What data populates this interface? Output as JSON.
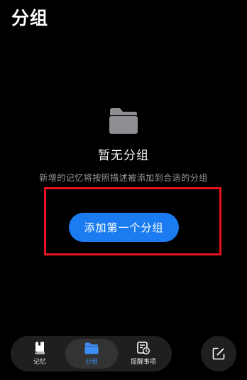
{
  "header": {
    "title": "分组"
  },
  "empty_state": {
    "icon": "folder-icon",
    "title": "暂无分组",
    "description": "新增的记忆将按照描述被添加到合适的分组"
  },
  "actions": {
    "add_first_group_label": "添加第一个分组"
  },
  "tabs": [
    {
      "label": "记忆",
      "icon": "book-icon",
      "active": false
    },
    {
      "label": "分组",
      "icon": "folder-icon",
      "active": true
    },
    {
      "label": "提醒事项",
      "icon": "reminder-icon",
      "active": false
    }
  ],
  "fab": {
    "icon": "edit-icon"
  },
  "colors": {
    "background": "#000000",
    "accent": "#1a7cf0",
    "highlight_border": "#e8121e",
    "icon_gray": "#8e8e93"
  }
}
